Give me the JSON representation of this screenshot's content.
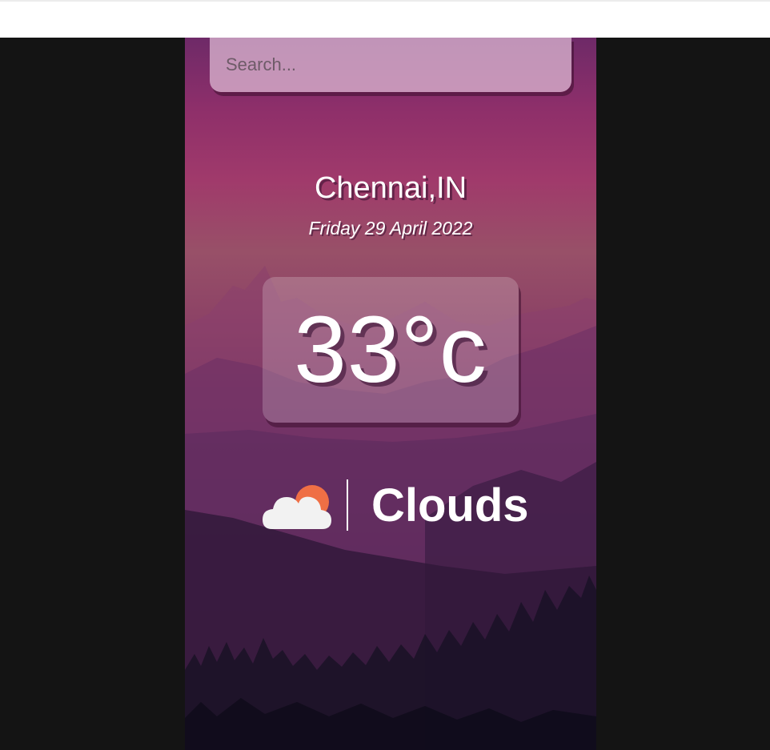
{
  "search": {
    "placeholder": "Search..."
  },
  "weather": {
    "location": "Chennai,IN",
    "date": "Friday 29 April 2022",
    "temperature": "33°c",
    "condition": "Clouds",
    "condition_icon": "cloud-sun-icon"
  },
  "colors": {
    "sun": "#ef6f45",
    "cloud": "#f2f2f2",
    "text": "#ffffff"
  }
}
